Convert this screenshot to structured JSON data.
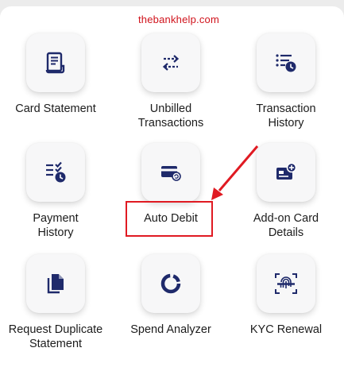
{
  "watermark": "thebankhelp.com",
  "accent_color": "#1f2a6b",
  "highlight_color": "#e01a22",
  "tiles": [
    {
      "label": "Card Statement",
      "icon": "receipt-icon"
    },
    {
      "label": "Unbilled\nTransactions",
      "icon": "swap-arrows-icon"
    },
    {
      "label": "Transaction\nHistory",
      "icon": "list-clock-icon"
    },
    {
      "label": "Payment\nHistory",
      "icon": "checklist-clock-icon"
    },
    {
      "label": "Auto Debit",
      "icon": "card-autopay-icon"
    },
    {
      "label": "Add-on Card\nDetails",
      "icon": "add-card-icon"
    },
    {
      "label": "Request Duplicate\nStatement",
      "icon": "duplicate-document-icon"
    },
    {
      "label": "Spend Analyzer",
      "icon": "donut-chart-icon"
    },
    {
      "label": "KYC Renewal",
      "icon": "fingerprint-scan-icon"
    }
  ]
}
